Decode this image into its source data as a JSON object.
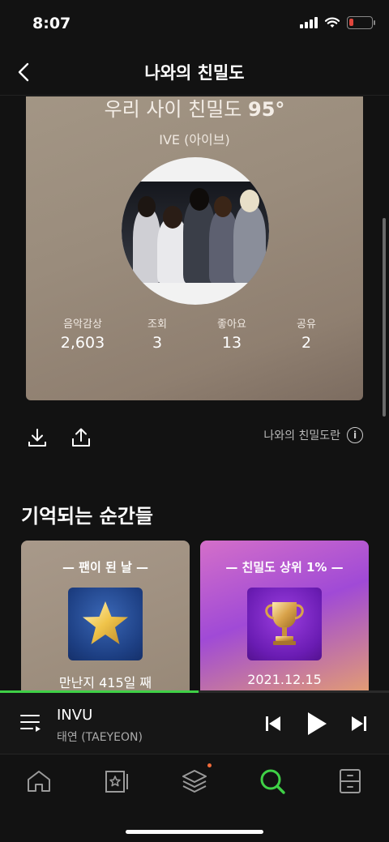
{
  "status_bar": {
    "time": "8:07",
    "battery_color": "#e0463c"
  },
  "header": {
    "title": "나와의 친밀도"
  },
  "intimacy_card": {
    "title_prefix": "우리 사이 친밀도 ",
    "score": "95°",
    "artist": "IVE (아이브)",
    "stats": [
      {
        "label": "음악감상",
        "value": "2,603"
      },
      {
        "label": "조회",
        "value": "3"
      },
      {
        "label": "좋아요",
        "value": "13"
      },
      {
        "label": "공유",
        "value": "2"
      }
    ]
  },
  "actions": {
    "about_label": "나와의 친밀도란",
    "download_icon": "download-icon",
    "share_icon": "share-icon"
  },
  "moments": {
    "title": "기억되는 순간들",
    "cards": [
      {
        "label": "— 팬이 된 날 —",
        "subtitle": "만난지 415일 째",
        "icon": "star-badge"
      },
      {
        "label": "— 친밀도 상위 1% —",
        "subtitle": "2021.12.15",
        "icon": "trophy-badge"
      }
    ]
  },
  "player": {
    "title": "INVU",
    "artist": "태연 (TAEYEON)",
    "progress": 0.51
  },
  "tab_bar": {
    "tabs": [
      "home-icon",
      "library-icon",
      "layers-icon",
      "search-icon",
      "storage-icon"
    ],
    "active_color": "#3fd046",
    "notification_color": "#f26b3a"
  }
}
